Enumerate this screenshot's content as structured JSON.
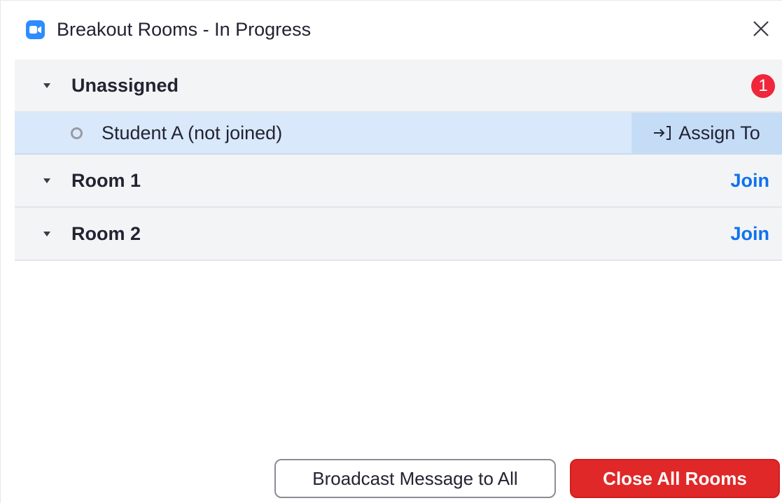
{
  "window": {
    "title": "Breakout Rooms - In Progress"
  },
  "groups": {
    "unassigned": {
      "label": "Unassigned",
      "badge_count": "1",
      "participant": {
        "name": "Student A (not joined)",
        "assign_label": "Assign To"
      }
    },
    "room1": {
      "label": "Room 1",
      "join_label": "Join"
    },
    "room2": {
      "label": "Room 2",
      "join_label": "Join"
    }
  },
  "footer": {
    "broadcast_label": "Broadcast Message to All",
    "close_all_label": "Close All Rooms"
  },
  "colors": {
    "accent_blue": "#0e72ed",
    "badge_red": "#f0263a",
    "close_red": "#e02828",
    "selected_row": "#d9e9fb"
  }
}
